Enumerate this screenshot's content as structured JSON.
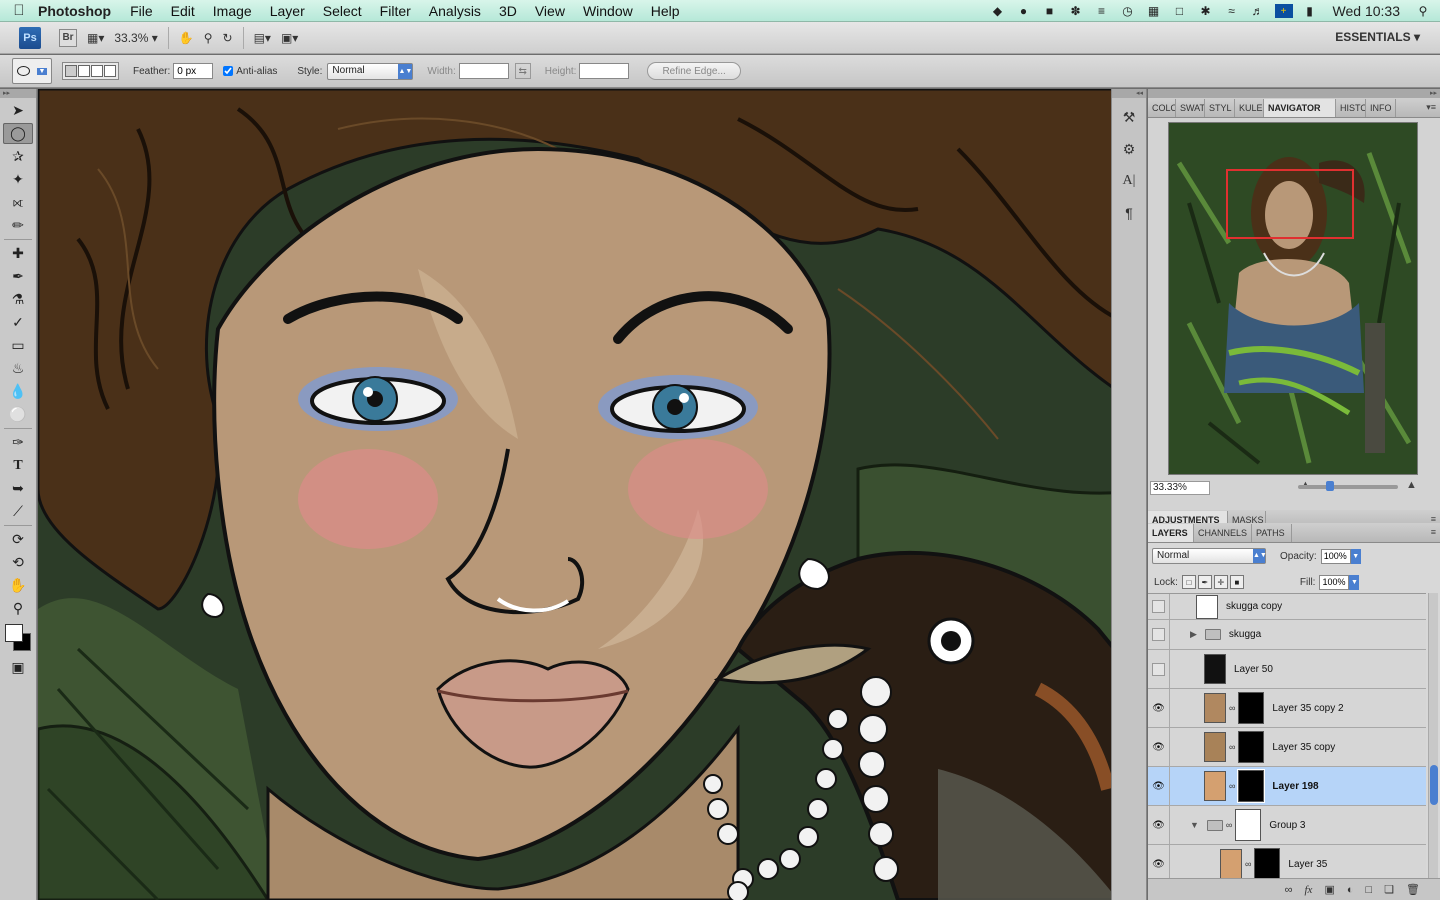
{
  "menubar": {
    "app_name": "Photoshop",
    "items": [
      "File",
      "Edit",
      "Image",
      "Layer",
      "Select",
      "Filter",
      "Analysis",
      "3D",
      "View",
      "Window",
      "Help"
    ],
    "clock": "Wed 10:33"
  },
  "appbar": {
    "ps_badge": "Ps",
    "br_badge": "Br",
    "zoom": "33.3%",
    "workspace": "ESSENTIALS"
  },
  "options": {
    "feather_label": "Feather:",
    "feather_value": "0 px",
    "antialias_label": "Anti-alias",
    "antialias_checked": true,
    "style_label": "Style:",
    "style_value": "Normal",
    "width_label": "Width:",
    "height_label": "Height:",
    "refine_edge": "Refine Edge..."
  },
  "top_panel_tabs": [
    {
      "label": "COLO",
      "active": false
    },
    {
      "label": "SWAT",
      "active": false
    },
    {
      "label": "STYL",
      "active": false
    },
    {
      "label": "KULE",
      "active": false
    },
    {
      "label": "NAVIGATOR",
      "active": true
    },
    {
      "label": "HISTO",
      "active": false
    },
    {
      "label": "INFO",
      "active": false
    }
  ],
  "navigator": {
    "zoom": "33.33%"
  },
  "adjust_tabs": [
    {
      "label": "ADJUSTMENTS",
      "active": true
    },
    {
      "label": "MASKS",
      "active": false
    }
  ],
  "layers_tabs": [
    {
      "label": "LAYERS",
      "active": true
    },
    {
      "label": "CHANNELS",
      "active": false
    },
    {
      "label": "PATHS",
      "active": false
    }
  ],
  "layers": {
    "blend_mode": "Normal",
    "opacity_label": "Opacity:",
    "opacity": "100%",
    "lock_label": "Lock:",
    "fill_label": "Fill:",
    "fill": "100%",
    "rows": [
      {
        "name": "skugga copy",
        "visible": false,
        "type": "layer"
      },
      {
        "name": "skugga",
        "visible": false,
        "type": "group"
      },
      {
        "name": "Layer 50",
        "visible": false,
        "type": "layer"
      },
      {
        "name": "Layer 35 copy 2",
        "visible": true,
        "type": "masked"
      },
      {
        "name": "Layer 35 copy",
        "visible": true,
        "type": "masked"
      },
      {
        "name": "Layer 198",
        "visible": true,
        "type": "masked",
        "selected": true
      },
      {
        "name": "Group 3",
        "visible": true,
        "type": "group-open"
      },
      {
        "name": "Layer 35",
        "visible": true,
        "type": "masked-indented"
      }
    ]
  },
  "colors": {
    "accent": "#4a7fd0",
    "selection": "#b6d4f8",
    "skin": "#b89878",
    "hair": "#4a3018",
    "navigator_frame": "#e03030"
  }
}
